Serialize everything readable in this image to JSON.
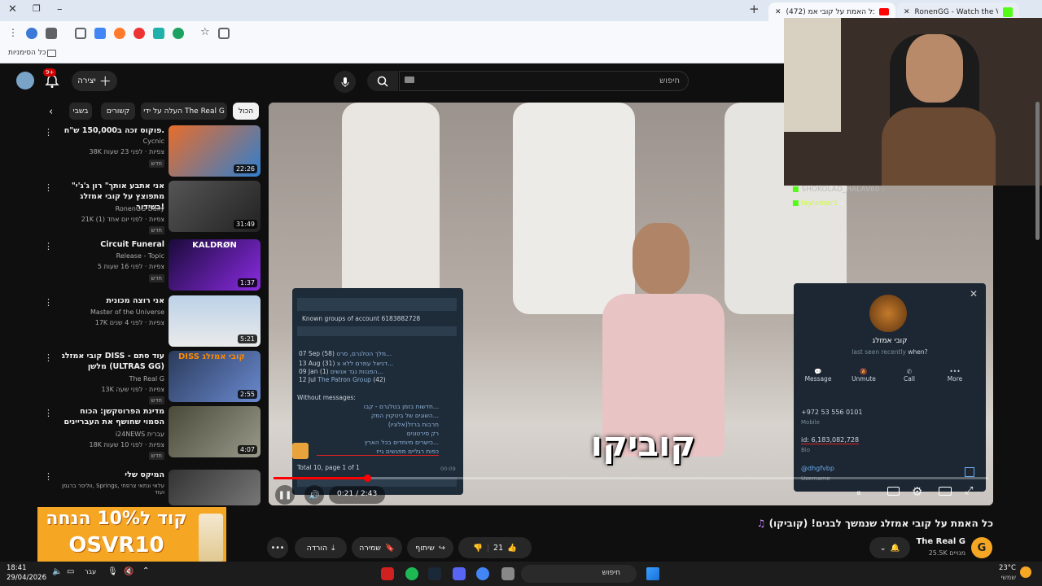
{
  "browser": {
    "tabs": [
      {
        "label": "(472) כל האמת על קובי אמ..."
      },
      {
        "label": "RonenGG - Watch the VOD on"
      }
    ],
    "bookmarks_label": "כל הסימניות",
    "new_tab": "+"
  },
  "youtube": {
    "search_placeholder": "חיפוש",
    "create_label": "יצירה",
    "notif_count": "9+",
    "chips": [
      "הכול",
      "העלה על ידי The Real G",
      "קשורים",
      "בשבי"
    ],
    "related": [
      {
        "title": "פוקוס זכה ב150,000 ש\"ח.",
        "channel": "Cycnic",
        "meta": "38K צפיות · לפני 23 שעות",
        "badge": "חדש",
        "duration": "22:26"
      },
      {
        "title": "\"אני אתבע אותך\" רון ג'ג'י מתפוצץ על קובי אמזלג בשידור!",
        "channel": "RonenGG Daily",
        "meta": "21K צפיות · לפני יום אחד (1)",
        "badge": "חדש",
        "duration": "31:49"
      },
      {
        "title": "Circuit Funeral",
        "channel": "Release - Topic",
        "meta": "5 צפיות · לפני 16 שעות",
        "badge": "חדש",
        "duration": "1:37",
        "thumb_text": "KALDRØN"
      },
      {
        "title": "אני רוצה מכונית",
        "channel": "Master of the Universe",
        "meta": "17K צפיות · לפני 4 שנים",
        "badge": "",
        "duration": "5:21"
      },
      {
        "title": "קובי אמזלג DISS - עוד סתם מלשן (ULTRAS GG)",
        "channel": "The Real G",
        "meta": "13K צפיות · לפני שעה",
        "badge": "חדש",
        "duration": "2:55",
        "thumb_text": "DISS קובי אמזלג"
      },
      {
        "title": "מדינת הפרוטקשן: הכוח הסמוי שחושף את העבריינים",
        "channel": "i24NEWS עברית",
        "meta": "18K צפיות · לפני 10 שעות",
        "badge": "חדש",
        "duration": "4:07"
      },
      {
        "title": "המיקס שלי",
        "channel": "ווליסר ברגמן, Springs, עלאי ונתאי צרפתי ועוד",
        "meta": "",
        "badge": "",
        "duration": ""
      }
    ],
    "video": {
      "title": "כל האמת על קובי אמזלג שנמשך לבנים! (קוביקו)",
      "caption": "קוביקו",
      "time": "0:21 / 2:43",
      "channel": "The Real G",
      "subs": "25.5K מנויים",
      "likes": "21",
      "share_label": "שיתוף",
      "save_label": "שמירה",
      "download_label": "הורדה"
    },
    "ad": {
      "line1": "קוד ל10% הנחה",
      "line2": "OSVR10"
    }
  },
  "stream": {
    "chat": [
      {
        "user": "SHOKOLAD_HALAV60",
        "text": ":"
      },
      {
        "user": "laylamar1",
        "text": ":"
      }
    ]
  },
  "tg_left": {
    "header": "Known groups of account 6183882728",
    "groups": [
      {
        "date": "07 Sep",
        "count": "(58)",
        "name": "מלך הטלגרם, סרט..."
      },
      {
        "date": "13 Aug",
        "count": "(31)",
        "name": "דניאל עמרם ללא צ..."
      },
      {
        "date": "09 Jan",
        "count": "(1)",
        "name": "הפגנות נגד אנשים..."
      },
      {
        "date": "12 Jul",
        "count": "(42)",
        "name": "The Patron Group"
      }
    ],
    "without_label": "Without messages:",
    "without": [
      "חדשות בזמן בטלגרם - קבו...",
      "השוגים של ביטקוין המק...",
      "חרבות ברזל(אלוניו)",
      "רק סירטונים",
      "כישרים מיוחדים בכל הארץ...",
      "כפות רגליים מפגשים גייז"
    ],
    "footer": "Total 10, page 1 of 1",
    "time": "00:09"
  },
  "tg_right": {
    "name": "קובי אמזלג",
    "status": "last seen recently",
    "when": "when?",
    "actions": [
      "Message",
      "Unmute",
      "Call",
      "More"
    ],
    "phone": "+972 53 556 0101",
    "phone_label": "Mobile",
    "id_value": "id: 6,183,082,728",
    "id_label": "Bio",
    "username": "@dhgfvbp",
    "username_label": "Username"
  },
  "taskbar": {
    "time": "18:41",
    "date": "29/04/2026",
    "lang": "עבר",
    "search_label": "חיפוש",
    "weather": "23°C",
    "weather_label": "שמשי"
  }
}
